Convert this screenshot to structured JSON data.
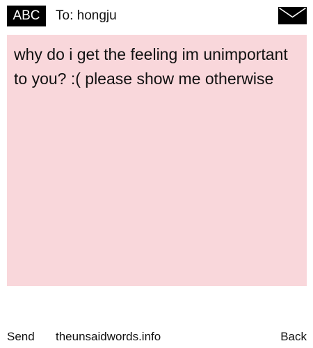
{
  "header": {
    "mode_label": "ABC",
    "recipient": "To: hongju",
    "icon": "envelope-icon"
  },
  "message": {
    "text": "why do i get the feeling im unimportant to you? :( please show me otherwise"
  },
  "colors": {
    "message_background": "#f9d7db",
    "badge_background": "#000000"
  },
  "footer": {
    "send_label": "Send",
    "site": "theunsaidwords.info",
    "back_label": "Back"
  }
}
